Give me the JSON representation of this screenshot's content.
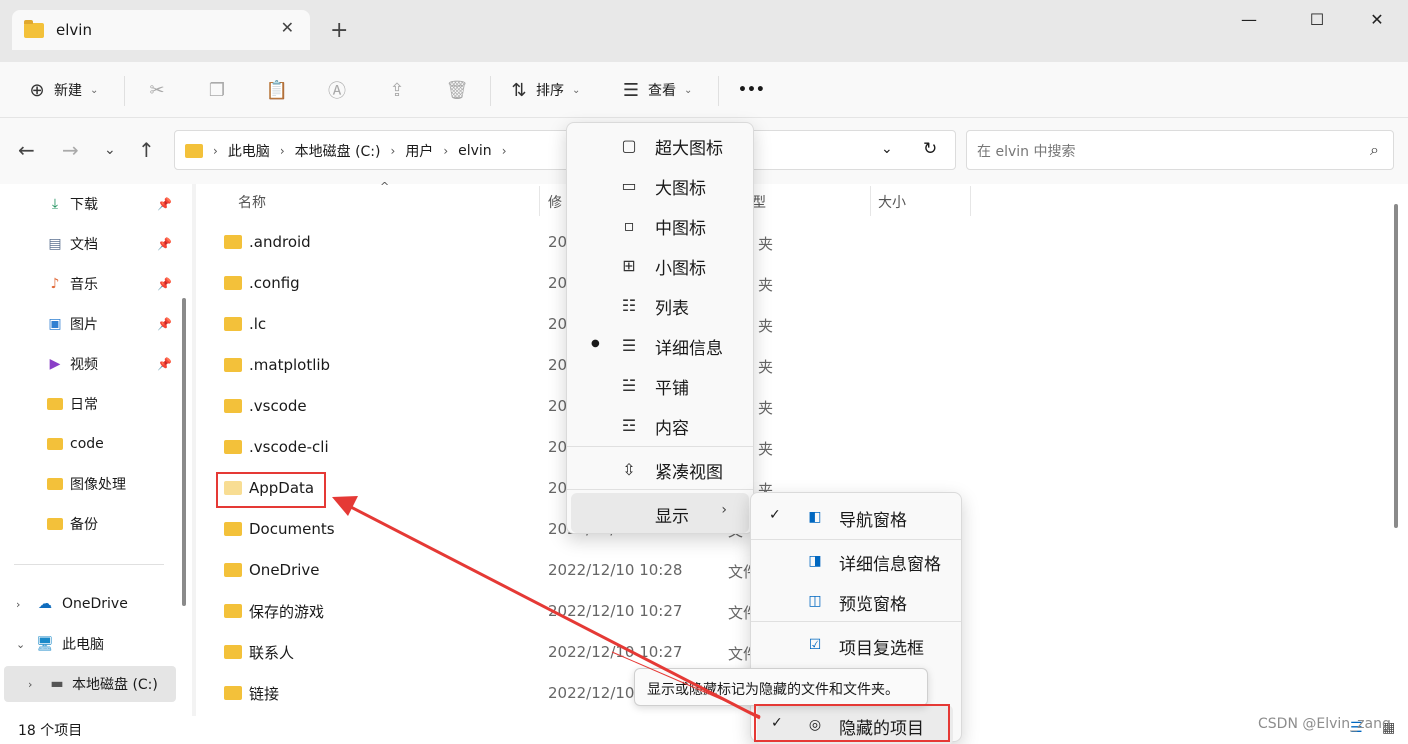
{
  "window": {
    "tab_title": "elvin",
    "close_tab_glyph": "✕",
    "new_tab_glyph": "+",
    "controls": [
      "minimize",
      "maximize",
      "close"
    ]
  },
  "toolbar": {
    "new_label": "新建",
    "sort_label": "排序",
    "view_label": "查看",
    "more_label": "•••",
    "icons": [
      "cut-icon",
      "copy-icon",
      "paste-icon",
      "rename-icon",
      "share-icon",
      "delete-icon"
    ]
  },
  "address": {
    "crumbs": [
      "此电脑",
      "本地磁盘 (C:)",
      "用户",
      "elvin"
    ]
  },
  "search": {
    "placeholder": "在 elvin 中搜索"
  },
  "sidebar": {
    "quick": [
      {
        "label": "下载",
        "icon": "download-icon",
        "pinned": true
      },
      {
        "label": "文档",
        "icon": "document-icon",
        "pinned": true
      },
      {
        "label": "音乐",
        "icon": "music-icon",
        "pinned": true
      },
      {
        "label": "图片",
        "icon": "picture-icon",
        "pinned": true
      },
      {
        "label": "视频",
        "icon": "video-icon",
        "pinned": true
      },
      {
        "label": "日常",
        "icon": "folder-icon",
        "pinned": false
      },
      {
        "label": "code",
        "icon": "folder-icon",
        "pinned": false
      },
      {
        "label": "图像处理",
        "icon": "folder-icon",
        "pinned": false
      },
      {
        "label": "备份",
        "icon": "folder-icon",
        "pinned": false
      }
    ],
    "onedrive": "OneDrive",
    "thispc": "此电脑",
    "cdrive": "本地磁盘 (C:)"
  },
  "columns": {
    "name": "名称",
    "modified": "修",
    "type": "型",
    "size": "大小"
  },
  "files": [
    {
      "name": ".android",
      "date": "20",
      "type": "夹"
    },
    {
      "name": ".config",
      "date": "20",
      "type": "夹"
    },
    {
      "name": ".lc",
      "date": "20",
      "type": "夹"
    },
    {
      "name": ".matplotlib",
      "date": "20",
      "type": "夹"
    },
    {
      "name": ".vscode",
      "date": "20",
      "type": "夹"
    },
    {
      "name": ".vscode-cli",
      "date": "20",
      "type": "夹"
    },
    {
      "name": "AppData",
      "date": "20",
      "type": "夹"
    },
    {
      "name": "Documents",
      "date": "2022/12/10 10:28",
      "type": "文"
    },
    {
      "name": "OneDrive",
      "date": "2022/12/10 10:28",
      "type": "文件"
    },
    {
      "name": "保存的游戏",
      "date": "2022/12/10 10:27",
      "type": "文件"
    },
    {
      "name": "联系人",
      "date": "2022/12/10 10:27",
      "type": "文件"
    },
    {
      "name": "链接",
      "date": "2022/12/10",
      "type": ""
    }
  ],
  "status": {
    "count": "18 个项目"
  },
  "view_menu": {
    "items": [
      {
        "label": "超大图标",
        "icon": "extra-large-icons-icon",
        "selected": false
      },
      {
        "label": "大图标",
        "icon": "large-icons-icon",
        "selected": false
      },
      {
        "label": "中图标",
        "icon": "medium-icons-icon",
        "selected": false
      },
      {
        "label": "小图标",
        "icon": "small-icons-icon",
        "selected": false
      },
      {
        "label": "列表",
        "icon": "list-icon",
        "selected": false
      },
      {
        "label": "详细信息",
        "icon": "details-icon",
        "selected": true
      },
      {
        "label": "平铺",
        "icon": "tiles-icon",
        "selected": false
      },
      {
        "label": "内容",
        "icon": "content-icon",
        "selected": false
      }
    ],
    "compact": "紧凑视图",
    "show": "显示"
  },
  "show_menu": {
    "nav_pane": "导航窗格",
    "details_pane": "详细信息窗格",
    "preview_pane": "预览窗格",
    "item_checkboxes": "项目复选框",
    "hidden_items": "隐藏的项目"
  },
  "tooltip": "显示或隐藏标记为隐藏的文件和文件夹。",
  "watermark": "CSDN @Elvin_zang",
  "colors": {
    "accent": "#0067c0",
    "annotation": "#e53935",
    "folder": "#f3c13a"
  }
}
